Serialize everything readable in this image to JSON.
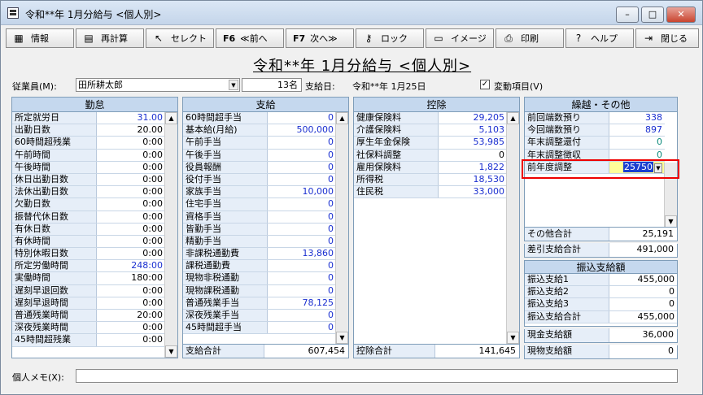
{
  "window": {
    "title": "令和**年 1月分給与 <個人別>",
    "min": "–",
    "max": "□",
    "close": "✕"
  },
  "toolbar": [
    {
      "icon": "▦",
      "label": "情報"
    },
    {
      "icon": "▤",
      "label": "再計算"
    },
    {
      "icon": "↖",
      "label": "セレクト"
    },
    {
      "key": "F6",
      "label": "≪前へ"
    },
    {
      "key": "F7",
      "label": "次へ≫"
    },
    {
      "icon": "⚷",
      "label": "ロック"
    },
    {
      "icon": "▭",
      "label": "イメージ"
    },
    {
      "icon": "⎙",
      "label": "印刷"
    },
    {
      "icon": "?",
      "label": "ヘルプ"
    },
    {
      "icon": "⇥",
      "label": "閉じる"
    }
  ],
  "page_title": "令和**年 1月分給与 <個人別>",
  "employee": {
    "label": "従業員(M):",
    "name": "田所耕太郎",
    "count": "13名",
    "paydate_label": "支給日:",
    "paydate": "令和**年 1月25日",
    "check": "✓",
    "variable_label": "変動項目(V)"
  },
  "kintai": {
    "title": "勤怠",
    "rows": [
      [
        "所定就労日",
        "31.00",
        "blue"
      ],
      [
        "出勤日数",
        "20.00",
        ""
      ],
      [
        "60時間超残業",
        "0:00",
        ""
      ],
      [
        "午前時間",
        "0:00",
        ""
      ],
      [
        "午後時間",
        "0:00",
        ""
      ],
      [
        "休日出勤日数",
        "0:00",
        ""
      ],
      [
        "法休出勤日数",
        "0:00",
        ""
      ],
      [
        "欠勤日数",
        "0:00",
        ""
      ],
      [
        "振替代休日数",
        "0:00",
        ""
      ],
      [
        "有休日数",
        "0:00",
        ""
      ],
      [
        "有休時間",
        "0:00",
        ""
      ],
      [
        "特別休暇日数",
        "0:00",
        ""
      ],
      [
        "所定労働時間",
        "248:00",
        "blue"
      ],
      [
        "実働時間",
        "180:00",
        ""
      ],
      [
        "遅刻早退回数",
        "0:00",
        ""
      ],
      [
        "遅刻早退時間",
        "0:00",
        ""
      ],
      [
        "普通残業時間",
        "20:00",
        ""
      ],
      [
        "深夜残業時間",
        "0:00",
        ""
      ],
      [
        "45時間超残業",
        "0:00",
        ""
      ]
    ]
  },
  "shikyu": {
    "title": "支給",
    "rows": [
      [
        "60時間超手当",
        "0",
        "blue"
      ],
      [
        "基本給(月給)",
        "500,000",
        "blue"
      ],
      [
        "午前手当",
        "0",
        "blue"
      ],
      [
        "午後手当",
        "0",
        "blue"
      ],
      [
        "役員報酬",
        "0",
        "blue"
      ],
      [
        "役付手当",
        "0",
        "blue"
      ],
      [
        "家族手当",
        "10,000",
        "blue"
      ],
      [
        "住宅手当",
        "0",
        "blue"
      ],
      [
        "資格手当",
        "0",
        "blue"
      ],
      [
        "皆勤手当",
        "0",
        "blue"
      ],
      [
        "精勤手当",
        "0",
        "blue"
      ],
      [
        "非課税通勤費",
        "13,860",
        "blue"
      ],
      [
        "課税通勤費",
        "0",
        "blue"
      ],
      [
        "現物非税通勤",
        "0",
        "blue"
      ],
      [
        "現物課税通勤",
        "0",
        "blue"
      ],
      [
        "普通残業手当",
        "78,125",
        "blue"
      ],
      [
        "深夜残業手当",
        "0",
        "blue"
      ],
      [
        "45時間超手当",
        "0",
        "blue"
      ]
    ],
    "total_label": "支給合計",
    "total": "607,454"
  },
  "kojo": {
    "title": "控除",
    "rows": [
      [
        "健康保険料",
        "29,205",
        "blue"
      ],
      [
        "介護保険料",
        "5,103",
        "blue"
      ],
      [
        "厚生年金保険",
        "53,985",
        "blue"
      ],
      [
        "社保料調整",
        "0",
        ""
      ],
      [
        "雇用保険料",
        "1,822",
        "blue"
      ],
      [
        "所得税",
        "18,530",
        "blue"
      ],
      [
        "住民税",
        "33,000",
        "blue"
      ]
    ],
    "total_label": "控除合計",
    "total": "141,645"
  },
  "kurikoshi": {
    "title": "繰越・その他",
    "rows": [
      [
        "前回端数預り",
        "338",
        "blue"
      ],
      [
        "今回端数預り",
        "897",
        "blue"
      ],
      [
        "年末調整還付",
        "0",
        "teal"
      ],
      [
        "年末調整徴収",
        "0",
        "teal"
      ],
      [
        "前年度調整",
        "25750",
        ""
      ]
    ],
    "other_total_label": "その他合計",
    "other_total": "25,191"
  },
  "sashihiki": {
    "label": "差引支給合計",
    "value": "491,000"
  },
  "furikomi": {
    "title": "振込支給額",
    "rows": [
      [
        "振込支給1",
        "455,000"
      ],
      [
        "振込支給2",
        "0"
      ],
      [
        "振込支給3",
        "0"
      ],
      [
        "振込支給合計",
        "455,000"
      ]
    ]
  },
  "genkin": {
    "label": "現金支給額",
    "value": "36,000"
  },
  "genbutsu": {
    "label": "現物支給額",
    "value": "0"
  },
  "memo": {
    "label": "個人メモ(X):",
    "value": ""
  },
  "colors": {
    "header": "#c5d8ee",
    "label_bg": "#e6eef8",
    "blue": "#1a2fd0",
    "highlight": "#ffff99",
    "alert": "#e00000"
  }
}
